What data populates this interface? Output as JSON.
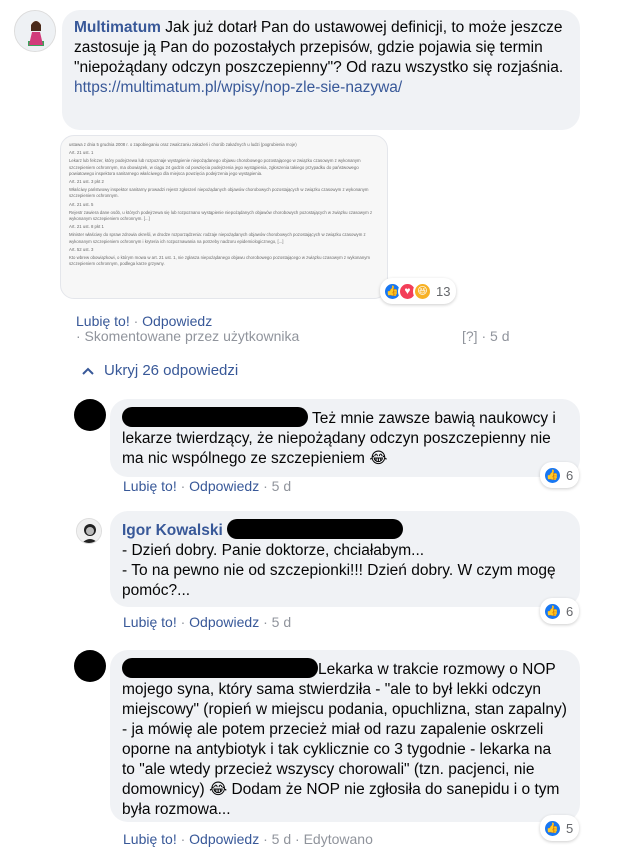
{
  "comments": [
    {
      "author": "Multimatum",
      "text": "Jak już dotarł Pan do ustawowej definicji, to może jeszcze zastosuje ją Pan do pozostałych przepisów, gdzie pojawia się termin \"niepożądany odczyn poszczepienny\"? Od razu wszystko się rozjaśnia.",
      "link": "https://multimatum.pl/wpisy/nop-zle-sie-nazywa/",
      "attachment_lines": [
        "ustawa z dnia 5 grudnia 2008 r. o zapobieganiu oraz zwalczaniu zakażeń i chorób zakaźnych u ludzi (pogrubienia moje)",
        "Art. 21 ust. 1",
        "Lekarz lub felczer, który podejrzewa lub rozpoznaje wystąpienie niepożądanego objawu chorobowego pozostającego w związku czasowym z wykonanym szczepieniem ochronnym, ma obowiązek, w ciągu 24 godzin od powzięcia podejrzenia jego wystąpienia, zgłoszenia takiego przypadku do państwowego powiatowego inspektora sanitarnego właściwego dla miejsca powzięcia podejrzenia jego wystąpienia.",
        "Art. 21 ust. 3 pkt 2",
        "Właściwy państwowy inspektor sanitarny prowadzi rejestr zgłoszeń niepożądanych objawów chorobowych pozostających w związku czasowym z wykonanym szczepieniem ochronnym.",
        "Art. 21 ust. 5",
        "Rejestr zawiera dane osób, u których podejrzewa się lub rozpoznano wystąpienie niepożądanych objawów chorobowych pozostających w związku czasowym z wykonanym szczepieniem ochronnym. [...]",
        "Art. 21 ust. 8 pkt 1",
        "Minister właściwy do spraw zdrowia określi, w drodze rozporządzenia: rodzaje niepożądanych objawów chorobowych pozostających w związku czasowym z wykonanym szczepieniem ochronnym i kryteria ich rozpoznawania na potrzeby nadzoru epidemiologicznego, [...]",
        "Art. 52 ust. 3",
        "Kto wbrew obowiązkowi, o którym mowa w art. 21 ust. 1, nie zgłasza niepożądanego objawu chorobowego pozostającego w związku czasowym z wykonanym szczepieniem ochronnym, podlega karze grzywny."
      ],
      "reactions_count": "13",
      "like_label": "Lubię to!",
      "reply_label": "Odpowiedz",
      "commented_by": "· Skomentowane przez użytkownika",
      "unknown": "[?]",
      "time": "5 d"
    }
  ],
  "toggle": {
    "label": "Ukryj 26 odpowiedzi"
  },
  "replies": [
    {
      "text": "Też mnie zawsze bawią naukowcy i lekarze twierdzący, że niepożądany odczyn poszczepienny nie ma nic wspólnego ze szczepieniem",
      "like_label": "Lubię to!",
      "reply_label": "Odpowiedz",
      "time": "5 d",
      "reactions_count": "6"
    },
    {
      "author": "Igor Kowalski",
      "line1": "- Dzień dobry. Panie doktorze, chciałabym...",
      "line2": "- To na pewno nie od szczepionki!!! Dzień dobry. W czym mogę pomóc?...",
      "like_label": "Lubię to!",
      "reply_label": "Odpowiedz",
      "time": "5 d",
      "reactions_count": "6"
    },
    {
      "text1": "Lekarka w trakcie rozmowy o NOP mojego syna, który sama stwierdziła - \"ale to był lekki odczyn miejscowy\" (ropień w miejscu podania, opuchlizna, stan zapalny) - ja mówię ale potem przecież miał od razu zapalenie oskrzeli oporne na antybiotyk i tak cyklicznie co 3 tygodnie - lekarka na to \"ale wtedy przecież wszyscy chorowali\" (tzn. pacjenci, nie domownicy)",
      "text2": "Dodam że NOP nie zgłosiła do sanepidu i o tym była rozmowa...",
      "like_label": "Lubię to!",
      "reply_label": "Odpowiedz",
      "time": "5 d",
      "edited": "Edytowano",
      "reactions_count": "5"
    }
  ],
  "colors": {
    "link": "#385898",
    "bubble": "#f0f2f5",
    "like": "#1877f2",
    "love": "#f33e58",
    "haha": "#f7b125"
  },
  "icons": [
    "avatar-icon",
    "like-icon",
    "love-icon",
    "haha-icon",
    "chevron-up-icon",
    "laugh-emoji-icon"
  ]
}
